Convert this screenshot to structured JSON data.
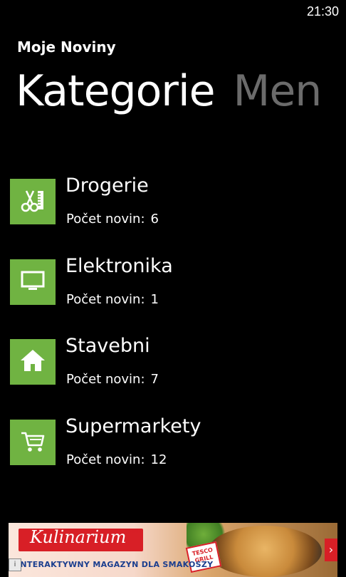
{
  "status_bar": {
    "time": "21:30"
  },
  "app": {
    "title": "Moje Noviny"
  },
  "pivot": {
    "active_header": "Kategorie",
    "inactive_header": "Men"
  },
  "categories": [
    {
      "name": "Drogerie",
      "count_label": "Počet novin:",
      "count": "6",
      "icon": "scissors-comb-icon"
    },
    {
      "name": "Elektronika",
      "count_label": "Počet novin:",
      "count": "1",
      "icon": "monitor-icon"
    },
    {
      "name": "Stavebni",
      "count_label": "Počet novin:",
      "count": "7",
      "icon": "home-icon"
    },
    {
      "name": "Supermarkety",
      "count_label": "Počet novin:",
      "count": "12",
      "icon": "shopping-cart-icon"
    }
  ],
  "ad": {
    "brand": "Kulinarium",
    "sponsor": "TESCO",
    "tagline": "INTERAKTYWNY MAGAZYN DLA SMAKOSZY",
    "stamp": "TESCO GRILL",
    "info": "i",
    "arrow": "›"
  },
  "colors": {
    "background": "#000000",
    "tile_accent": "#70b342",
    "inactive_header": "#6b6b6b"
  }
}
